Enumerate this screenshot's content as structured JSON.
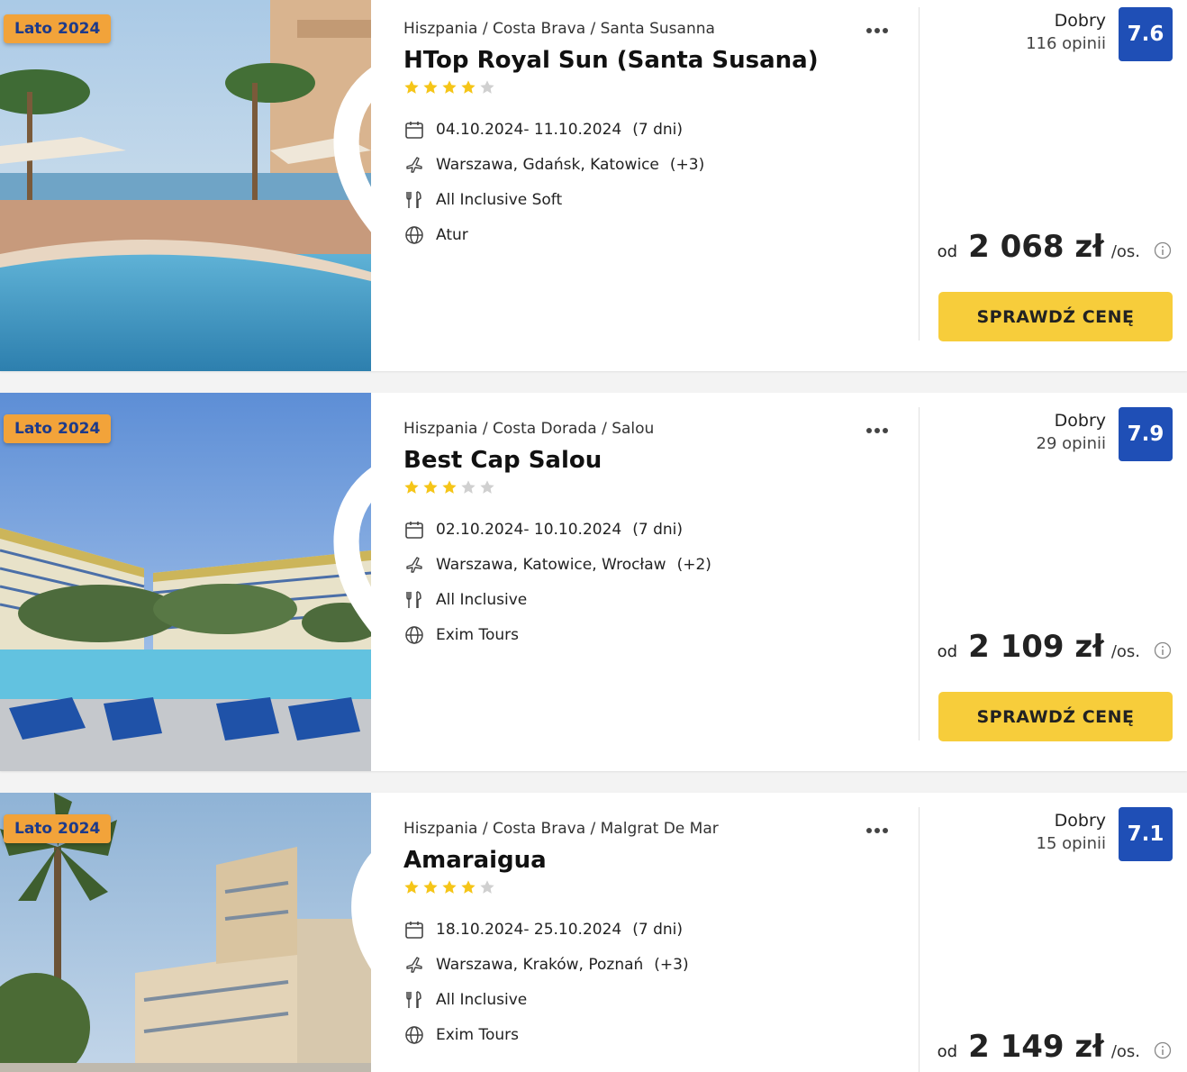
{
  "offers": [
    {
      "badge": "Lato 2024",
      "breadcrumb": "Hiszpania / Costa Brava / Santa Susanna",
      "title": "HTop Royal Sun (Santa Susana)",
      "stars": 4,
      "dates": "04.10.2024- 11.10.2024",
      "duration": "(7 dni)",
      "departures": "Warszawa, Gdańsk, Katowice",
      "departures_more": "(+3)",
      "board": "All Inclusive Soft",
      "operator": "Atur",
      "rating_word": "Dobry",
      "rating_count": "116 opinii",
      "score": "7.6",
      "price_prefix": "od",
      "price": "2 068 zł",
      "price_suffix": "/os.",
      "cta": "SPRAWDŹ CENĘ"
    },
    {
      "badge": "Lato 2024",
      "breadcrumb": "Hiszpania / Costa Dorada / Salou",
      "title": "Best Cap Salou",
      "stars": 3,
      "dates": "02.10.2024- 10.10.2024",
      "duration": "(7 dni)",
      "departures": "Warszawa, Katowice, Wrocław",
      "departures_more": "(+2)",
      "board": "All Inclusive",
      "operator": "Exim Tours",
      "rating_word": "Dobry",
      "rating_count": "29 opinii",
      "score": "7.9",
      "price_prefix": "od",
      "price": "2 109 zł",
      "price_suffix": "/os.",
      "cta": "SPRAWDŹ CENĘ"
    },
    {
      "badge": "Lato 2024",
      "breadcrumb": "Hiszpania / Costa Brava / Malgrat De Mar",
      "title": "Amaraigua",
      "stars": 4,
      "dates": "18.10.2024- 25.10.2024",
      "duration": "(7 dni)",
      "departures": "Warszawa, Kraków, Poznań",
      "departures_more": "(+3)",
      "board": "All Inclusive",
      "operator": "Exim Tours",
      "rating_word": "Dobry",
      "rating_count": "15 opinii",
      "score": "7.1",
      "price_prefix": "od",
      "price": "2 149 zł",
      "price_suffix": "/os."
    }
  ],
  "colors": {
    "badge_bg": "#f2a33a",
    "badge_text": "#1d3a8a",
    "score_bg": "#1f4fb6",
    "cta_bg": "#f7cd3b",
    "star_filled": "#f5c518",
    "star_empty": "#d0d0d0"
  },
  "icons": [
    "heart-icon",
    "more-dots-icon",
    "calendar-icon",
    "plane-icon",
    "cutlery-icon",
    "globe-icon",
    "info-icon",
    "star-icon"
  ]
}
